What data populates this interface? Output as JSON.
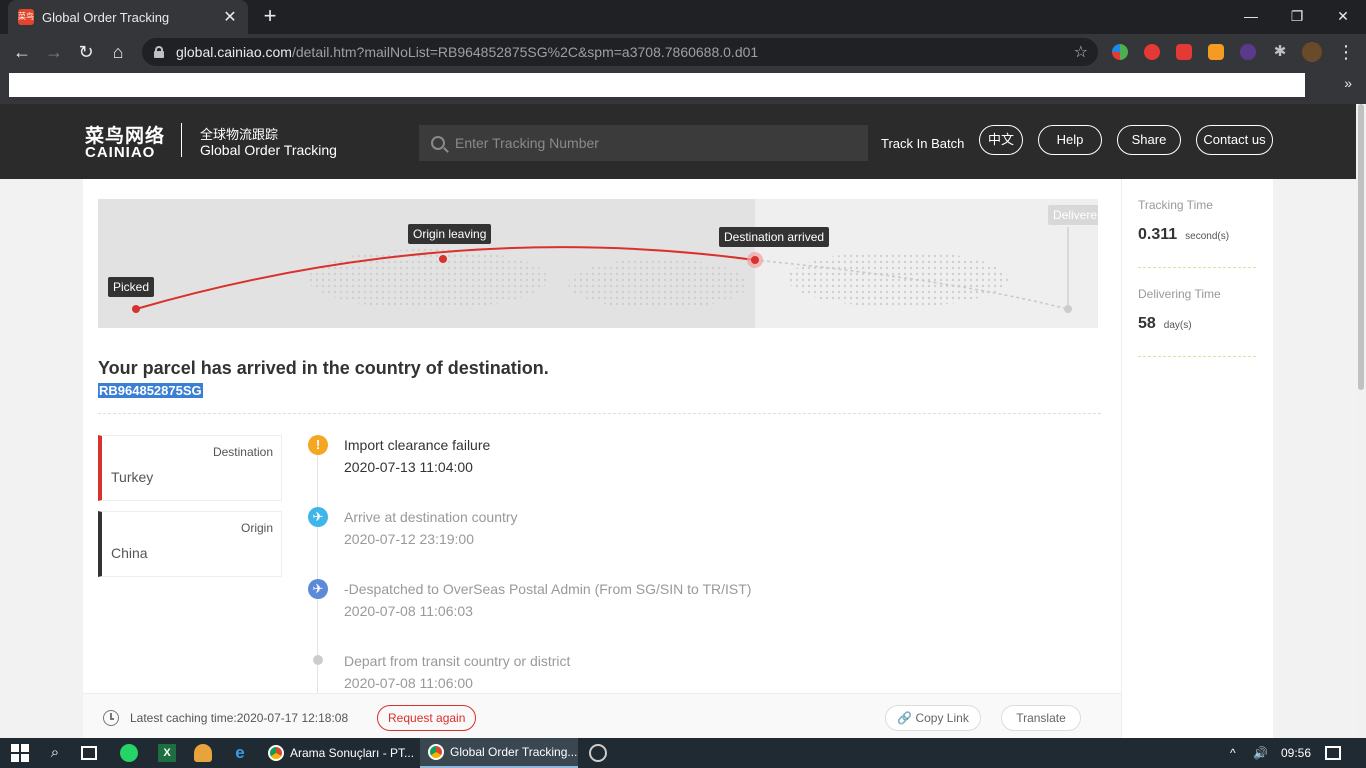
{
  "browser": {
    "tab_title": "Global Order Tracking",
    "tab_favicon_text": "菜鸟",
    "url_host": "global.cainiao.com",
    "url_path": "/detail.htm?mailNoList=RB964852875SG%2C&spm=a3708.7860688.0.d01"
  },
  "header": {
    "logo_cn": "菜鸟网络",
    "logo_en": "CAINIAO",
    "subtitle_cn": "全球物流跟踪",
    "subtitle_en": "Global Order Tracking",
    "search_placeholder": "Enter Tracking Number",
    "track_batch": "Track In Batch",
    "nav": [
      "中文",
      "Help",
      "Share",
      "Contact us"
    ]
  },
  "map": {
    "labels": [
      "Picked",
      "Origin leaving",
      "Destination arrived",
      "Delivere"
    ]
  },
  "status": {
    "headline": "Your parcel has arrived in the country of destination.",
    "tracking_number": "RB964852875SG"
  },
  "route": {
    "destination_label": "Destination",
    "destination_value": "Turkey",
    "origin_label": "Origin",
    "origin_value": "China"
  },
  "events": [
    {
      "title": "Import clearance failure",
      "time": "2020-07-13 11:04:00",
      "icon": "alert-icon",
      "color": "#f5a623"
    },
    {
      "title": "Arrive at destination country",
      "time": "2020-07-12 23:19:00",
      "icon": "plane-landing-icon",
      "color": "#3fb6e8"
    },
    {
      "title": "-Despatched to OverSeas Postal Admin (From SG/SIN to TR/IST)",
      "time": "2020-07-08 11:06:03",
      "icon": "plane-takeoff-icon",
      "color": "#5b8bd8"
    },
    {
      "title": "Depart from transit country or district",
      "time": "2020-07-08 11:06:00",
      "icon": "dot-icon",
      "color": "#cccccc"
    }
  ],
  "footer": {
    "cache_text": "Latest caching time:2020-07-17 12:18:08",
    "request_again": "Request again",
    "copy_link": "Copy Link",
    "translate": "Translate"
  },
  "sidebar": {
    "tracking_time_label": "Tracking Time",
    "tracking_time_value": "0.311",
    "tracking_time_unit": "second(s)",
    "delivering_time_label": "Delivering Time",
    "delivering_time_value": "58",
    "delivering_time_unit": "day(s)"
  },
  "taskbar": {
    "app1": "Arama Sonuçları - PT...",
    "app2": "Global Order Tracking...",
    "time": "09:56"
  },
  "colors": {
    "accent_red": "#d9312b",
    "header_bg": "#2b2b2b",
    "highlight_blue": "#3b7fd4"
  }
}
